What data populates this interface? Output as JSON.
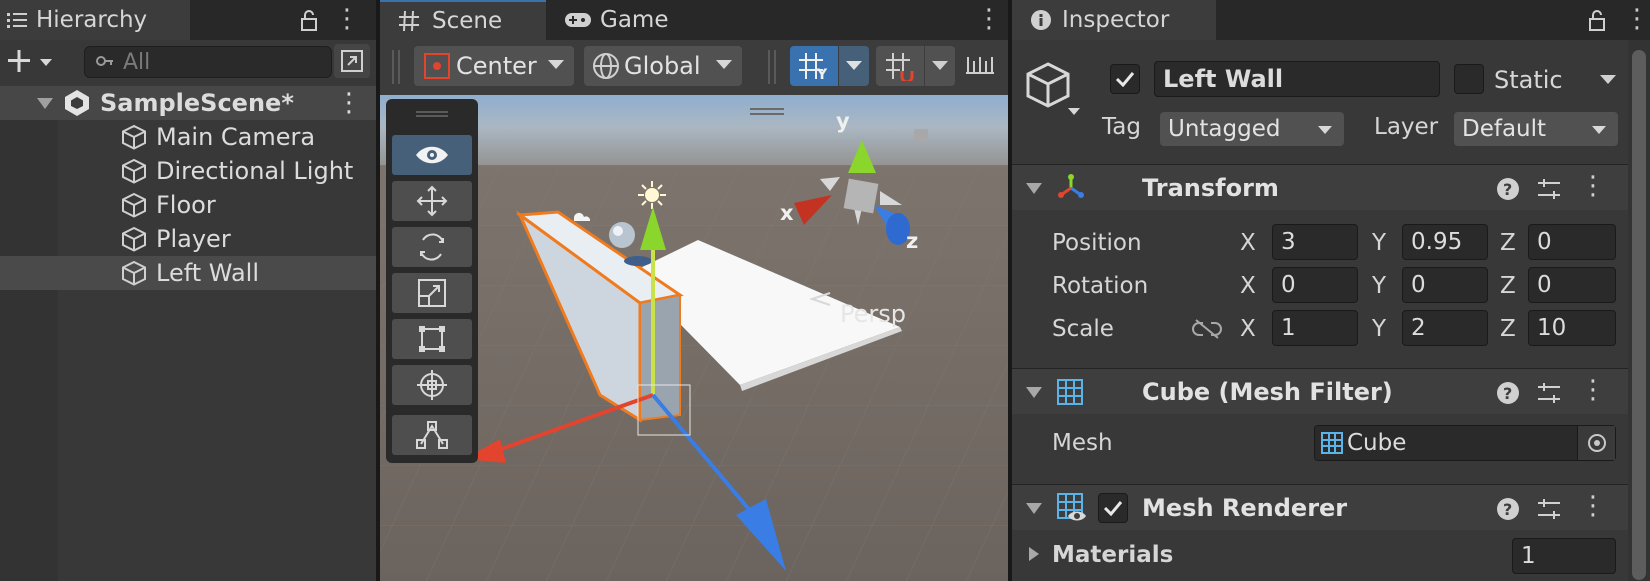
{
  "hierarchy": {
    "tab_label": "Hierarchy",
    "search_placeholder": "All",
    "scene_name": "SampleScene*",
    "items": [
      {
        "label": "Main Camera"
      },
      {
        "label": "Directional Light"
      },
      {
        "label": "Floor"
      },
      {
        "label": "Player"
      },
      {
        "label": "Left Wall"
      }
    ],
    "selected_index": 4
  },
  "scene_view": {
    "tabs": [
      {
        "label": "Scene"
      },
      {
        "label": "Game"
      }
    ],
    "pivot_mode": "Center",
    "pivot_rotation": "Global",
    "camera_label": "Persp",
    "gizmo_axes": {
      "x": "x",
      "y": "y",
      "z": "z"
    },
    "tools": [
      "view-tool",
      "move-tool",
      "rotate-tool",
      "scale-tool",
      "rect-tool",
      "transform-tool",
      "custom-tool"
    ],
    "active_tool": "view-tool"
  },
  "inspector": {
    "tab_label": "Inspector",
    "object_name": "Left Wall",
    "active": true,
    "static_label": "Static",
    "static_checked": false,
    "tag_label": "Tag",
    "tag_value": "Untagged",
    "layer_label": "Layer",
    "layer_value": "Default",
    "transform": {
      "title": "Transform",
      "position": {
        "label": "Position",
        "x": "3",
        "y": "0.95",
        "z": "0"
      },
      "rotation": {
        "label": "Rotation",
        "x": "0",
        "y": "0",
        "z": "0"
      },
      "scale": {
        "label": "Scale",
        "x": "1",
        "y": "2",
        "z": "10"
      },
      "axis_x": "X",
      "axis_y": "Y",
      "axis_z": "Z"
    },
    "mesh_filter": {
      "title": "Cube (Mesh Filter)",
      "mesh_label": "Mesh",
      "mesh_value": "Cube"
    },
    "mesh_renderer": {
      "title": "Mesh Renderer",
      "enabled": true,
      "materials_label": "Materials",
      "materials_count": "1"
    }
  },
  "colors": {
    "accent_blue": "#3a72b0",
    "selection": "#4a4a4a",
    "axis_x": "#e2442e",
    "axis_y": "#8ad62c",
    "axis_z": "#3a7de4",
    "outline_orange": "#f07a1e"
  }
}
